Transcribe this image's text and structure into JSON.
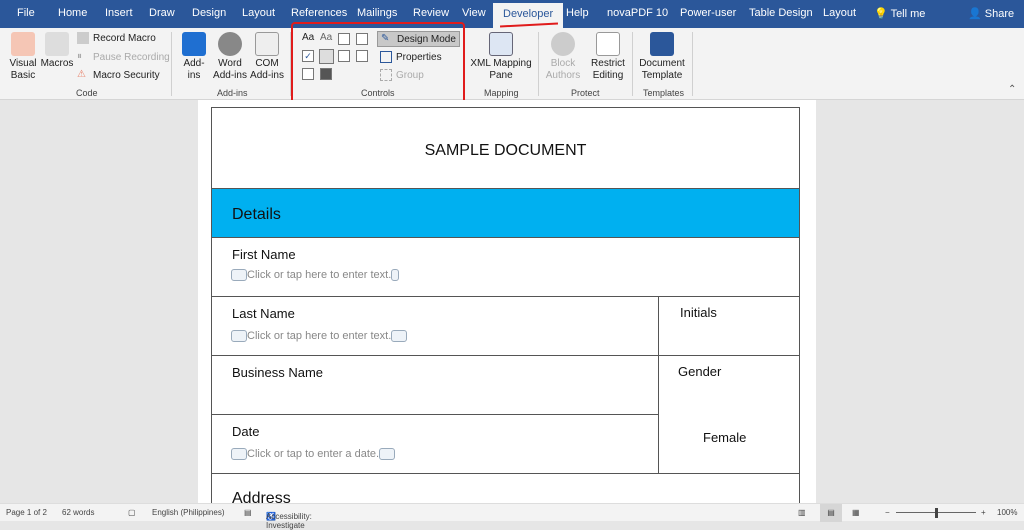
{
  "tabs": [
    "File",
    "Home",
    "Insert",
    "Draw",
    "Design",
    "Layout",
    "References",
    "Mailings",
    "Review",
    "View",
    "Developer",
    "Help",
    "novaPDF 10",
    "Power-user",
    "Table Design",
    "Layout"
  ],
  "active_tab": "Developer",
  "tell_me": "Tell me",
  "share": "Share",
  "ribbon": {
    "code": {
      "label": "Code",
      "visual_basic": "Visual Basic",
      "macros": "Macros",
      "record_macro": "Record Macro",
      "pause_recording": "Pause Recording",
      "macro_security": "Macro Security"
    },
    "addins": {
      "label": "Add-ins",
      "addins": "Add-ins",
      "word_addins": "Word Add-ins",
      "com_addins": "COM Add-ins"
    },
    "controls": {
      "label": "Controls",
      "design_mode": "Design Mode",
      "properties": "Properties",
      "group": "Group"
    },
    "mapping": {
      "label": "Mapping",
      "xml_mapping_pane": "XML Mapping Pane"
    },
    "protect": {
      "label": "Protect",
      "block_authors": "Block Authors",
      "restrict_editing": "Restrict Editing"
    },
    "templates": {
      "label": "Templates",
      "document_template": "Document Template"
    }
  },
  "document": {
    "title": "SAMPLE DOCUMENT",
    "section": "Details",
    "first_name": "First Name",
    "last_name": "Last Name",
    "initials": "Initials",
    "business_name": "Business Name",
    "gender": "Gender",
    "gender_value": "Female",
    "date": "Date",
    "address": "Address",
    "placeholder_text": "Click or tap here to enter text.",
    "placeholder_date": "Click or tap to enter a date."
  },
  "status": {
    "page": "Page 1 of 2",
    "words": "62 words",
    "language": "English (Philippines)",
    "accessibility": "Accessibility: Investigate",
    "zoom": "100%",
    "zoom_level": 100
  },
  "colors": {
    "tabbar": "#2b579a",
    "section_header": "#00b0f0",
    "highlight": "#e01b1b"
  }
}
